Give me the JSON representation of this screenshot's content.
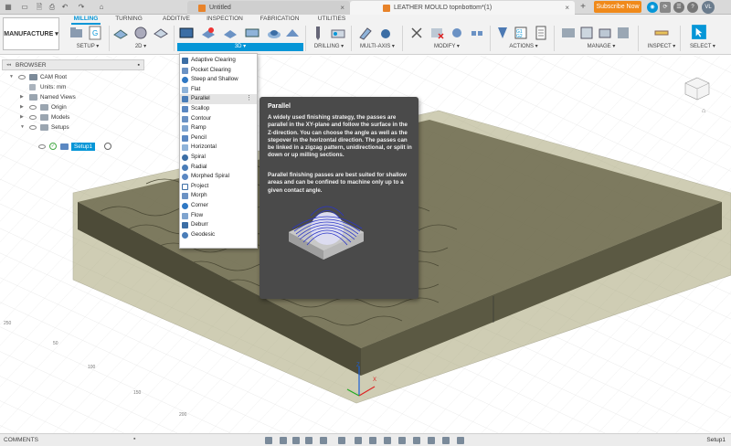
{
  "tabs": {
    "doc_untitled": "Untitled",
    "doc_active": "LEATHER MOULD topnbottom*(1)",
    "subscribe": "Subscribe Now",
    "user_initials": "VL"
  },
  "toolbar": {
    "workspace": "MANUFACTURE",
    "ribbon_tabs": [
      "MILLING",
      "TURNING",
      "ADDITIVE",
      "INSPECTION",
      "FABRICATION",
      "UTILITIES"
    ],
    "groups": {
      "setup": "SETUP",
      "g2d": "2D",
      "g3d": "3D",
      "drilling": "DRILLING",
      "multiaxis": "MULTI-AXIS",
      "modify": "MODIFY",
      "actions": "ACTIONS",
      "manage": "MANAGE",
      "inspect": "INSPECT",
      "select": "SELECT"
    }
  },
  "browser": {
    "title": "BROWSER",
    "items": {
      "root": "CAM Root",
      "units": "Units: mm",
      "named_views": "Named Views",
      "origin": "Origin",
      "models": "Models",
      "setups": "Setups",
      "setup1": "Setup1"
    }
  },
  "menu": {
    "items": [
      "Adaptive Clearing",
      "Pocket Clearing",
      "Steep and Shallow",
      "Flat",
      "Parallel",
      "Scallop",
      "Contour",
      "Ramp",
      "Pencil",
      "Horizontal",
      "Spiral",
      "Radial",
      "Morphed Spiral",
      "Project",
      "Morph",
      "Corner",
      "Flow",
      "Deburr",
      "Geodesic"
    ],
    "highlighted": "Parallel"
  },
  "tooltip": {
    "title": "Parallel",
    "p1": "A widely used finishing strategy, the passes are parallel in the XY-plane and follow the surface in the Z-direction. You can choose the angle as well as the stepover in the horizontal direction. The passes can be linked in a zigzag pattern, unidirectional, or split in down or up milling sections.",
    "p2": "Parallel finishing passes are best suited for shallow areas and can be confined to machine only up to a given contact angle."
  },
  "viewport": {
    "dims": [
      "50",
      "100",
      "150",
      "200",
      "250"
    ],
    "axis_z": "Z",
    "axis_x": "X"
  },
  "status": {
    "comments": "COMMENTS",
    "active_setup": "Setup1"
  },
  "colors": {
    "accent": "#0696d7",
    "subscribe": "#f08a1b",
    "model_fill": "#6e6b50",
    "stock": "#a9a678"
  }
}
